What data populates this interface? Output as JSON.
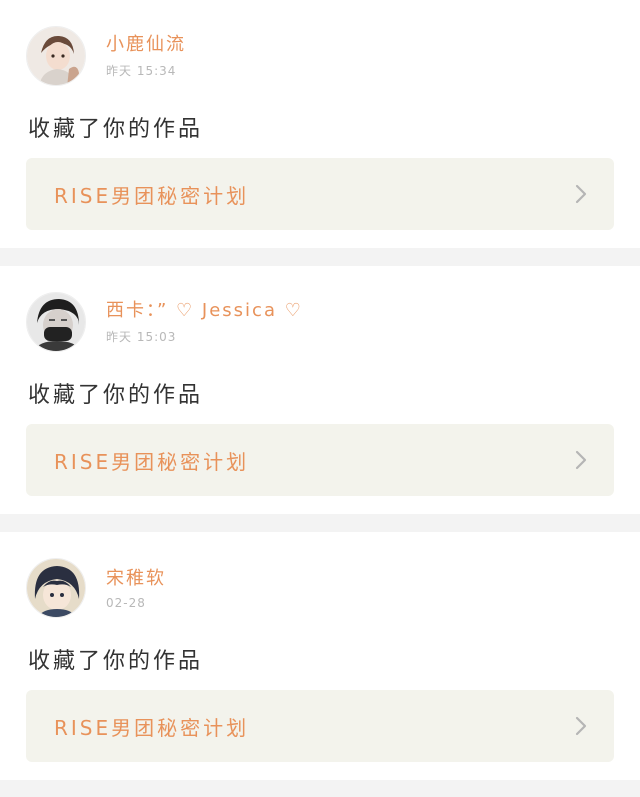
{
  "notifications": [
    {
      "username": "小鹿仙流",
      "timestamp": "昨天 15:34",
      "action": "收藏了你的作品",
      "work_title": "RISE男团秘密计划",
      "avatar_icon": "user-avatar-icon"
    },
    {
      "username": "西卡：” ♡ Jessica ♡",
      "timestamp": "昨天 15:03",
      "action": "收藏了你的作品",
      "work_title": "RISE男团秘密计划",
      "avatar_icon": "user-avatar-icon"
    },
    {
      "username": "宋稚软",
      "timestamp": "02-28",
      "action": "收藏了你的作品",
      "work_title": "RISE男团秘密计划",
      "avatar_icon": "user-avatar-icon"
    }
  ],
  "colors": {
    "accent": "#e8925a",
    "card_bg": "#ffffff",
    "page_bg": "#f3f3f3",
    "link_bg": "#f3f3ec",
    "text": "#333333",
    "muted": "#b8b8b8"
  }
}
